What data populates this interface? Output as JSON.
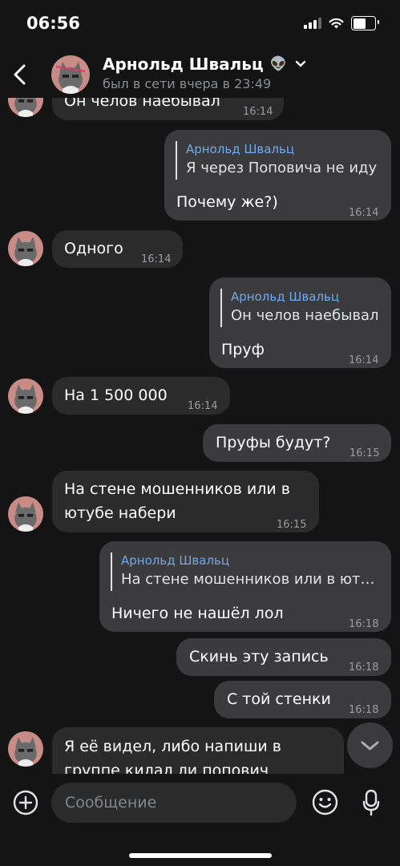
{
  "status_bar": {
    "time": "06:56",
    "battery_level": 0.6
  },
  "header": {
    "name": "Арнольд Швальц",
    "emoji": "👽",
    "status": "был в сети вчера в 23:49"
  },
  "messages": [
    {
      "side": "in",
      "text": "Он челов наебывал",
      "time": "16:14"
    },
    {
      "side": "out",
      "quote_author": "Арнольд Швальц",
      "quote_text": "Я через Поповича не иду",
      "text": "Почему же?)",
      "time": "16:14"
    },
    {
      "side": "in",
      "text": "Одного",
      "time": "16:14"
    },
    {
      "side": "out",
      "quote_author": "Арнольд Швальц",
      "quote_text": "Он челов наебывал",
      "text": "Пруф",
      "time": "16:14"
    },
    {
      "side": "in",
      "text": "На 1 500 000",
      "time": "16:14"
    },
    {
      "side": "out",
      "text": "Пруфы будут?",
      "time": "16:15"
    },
    {
      "side": "in",
      "line1": "На стене мошенников или в",
      "line2": "ютубе набери",
      "time": "16:15"
    },
    {
      "side": "out",
      "quote_author": "Арнольд Швальц",
      "quote_text": "На стене мошенников или в юту...",
      "text": "Ничего не нашёл лол",
      "time": "16:18"
    },
    {
      "side": "out",
      "text": "Скинь эту запись",
      "time": "16:18"
    },
    {
      "side": "out",
      "text": "С той стенки",
      "time": "16:18"
    },
    {
      "side": "in",
      "line1": "Я её видел, либо напиши в",
      "line2": "группе килал ли попович"
    }
  ],
  "composer": {
    "placeholder": "Сообщение"
  },
  "icons": {
    "back": "chevron-left-icon",
    "dropdown": "chevron-down-icon",
    "scroll": "chevron-down-icon",
    "attach": "plus-circle-icon",
    "emoji": "smile-icon",
    "voice": "microphone-icon"
  },
  "colors": {
    "background": "#141414",
    "incoming_bubble": "#2b2b2b",
    "outgoing_bubble": "#3b3b3d",
    "quote_author": "#71aaeb",
    "meta_text": "#8a8d91"
  }
}
